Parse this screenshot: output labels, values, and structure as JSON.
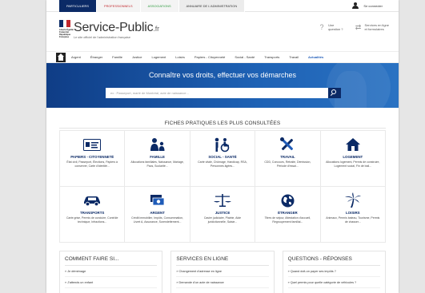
{
  "top_tabs": [
    {
      "label": "Particuliers",
      "key": "particuliers"
    },
    {
      "label": "Professionnels",
      "key": "professionnels"
    },
    {
      "label": "Associations",
      "key": "associations"
    },
    {
      "label": "Annuaire de l'administration",
      "key": "annuaire"
    }
  ],
  "login_label": "Se connecter",
  "brand": {
    "rf_text": "Liberté Égalité Fraternité République Française",
    "name": "Service-Public",
    "suffix": ".fr",
    "subtitle": "Le site officiel de l'administration française"
  },
  "quick_links": [
    {
      "line1": "Une",
      "line2": "question ?",
      "icon": "question-icon"
    },
    {
      "line1": "Services en ligne",
      "line2": "et formulaires",
      "icon": "arrows-icon"
    }
  ],
  "nav": [
    {
      "label": "Argent"
    },
    {
      "label": "Étranger"
    },
    {
      "label": "Famille"
    },
    {
      "label": "Justice"
    },
    {
      "label": "Logement"
    },
    {
      "label": "Loisirs"
    },
    {
      "label": "Papiers - Citoyenneté"
    },
    {
      "label": "Social - Santé"
    },
    {
      "label": "Transports"
    },
    {
      "label": "Travail"
    },
    {
      "label": "Actualités",
      "active": true
    }
  ],
  "hero": {
    "title": "Connaître vos droits, effectuer vos démarches",
    "search_placeholder": "ex : Passeport, marié de Montréal, acte de naissance..."
  },
  "fiches": {
    "title": "FICHES PRATIQUES LES PLUS CONSULTÉES",
    "items": [
      {
        "title": "Papiers - Citoyenneté",
        "desc": "État civil, Passeport, Élections, Papiers à conserver, Carte d'identité...",
        "icon": "id-card-icon"
      },
      {
        "title": "Famille",
        "desc": "Allocations familiales, Naissance, Mariage, Pacs, Scolarité...",
        "icon": "family-icon"
      },
      {
        "title": "Social - Santé",
        "desc": "Carte vitale, Chômage, Handicap, RSA, Personnes âgées...",
        "icon": "wheelchair-icon"
      },
      {
        "title": "Travail",
        "desc": "CDD, Concours, Retraite, Démission, Période d'essai...",
        "icon": "tools-icon"
      },
      {
        "title": "Logement",
        "desc": "Allocations logement, Permis de construire, Logement social, Fin de bail...",
        "icon": "house-icon"
      },
      {
        "title": "Transports",
        "desc": "Carte grise, Permis de conduire, Contrôle technique, Infractions...",
        "icon": "car-icon"
      },
      {
        "title": "Argent",
        "desc": "Crédit immobilier, Impôts, Consommation, Livret A, Assurance, Surendettement...",
        "icon": "money-icon"
      },
      {
        "title": "Justice",
        "desc": "Casier judiciaire, Plainte, Aide juridictionnelle, Saisie...",
        "icon": "scales-icon"
      },
      {
        "title": "Étranger",
        "desc": "Titres de séjour, Attestation d'accueil, Regroupement familial...",
        "icon": "globe-icon"
      },
      {
        "title": "Loisirs",
        "desc": "Animaux, Permis bateau, Tourisme, Permis de chasser...",
        "icon": "palm-tree-icon"
      }
    ]
  },
  "bottom": [
    {
      "title": "COMMENT FAIRE SI...",
      "links": [
        "Je déménage",
        "J'attends un enfant"
      ]
    },
    {
      "title": "SERVICES EN LIGNE",
      "links": [
        "Changement d'adresse en ligne",
        "Demande d'un acte de naissance"
      ]
    },
    {
      "title": "QUESTIONS - RÉPONSES",
      "links": [
        "Quand doit-on payer ses impôts ?",
        "Quel permis pour quelle catégorie de véhicules ?"
      ]
    }
  ],
  "colors": {
    "navy": "#0b2a66",
    "hero_blue": "#1e62b5",
    "red": "#c1272d",
    "green": "#2e9a3f",
    "link_blue": "#1e5bb8"
  }
}
